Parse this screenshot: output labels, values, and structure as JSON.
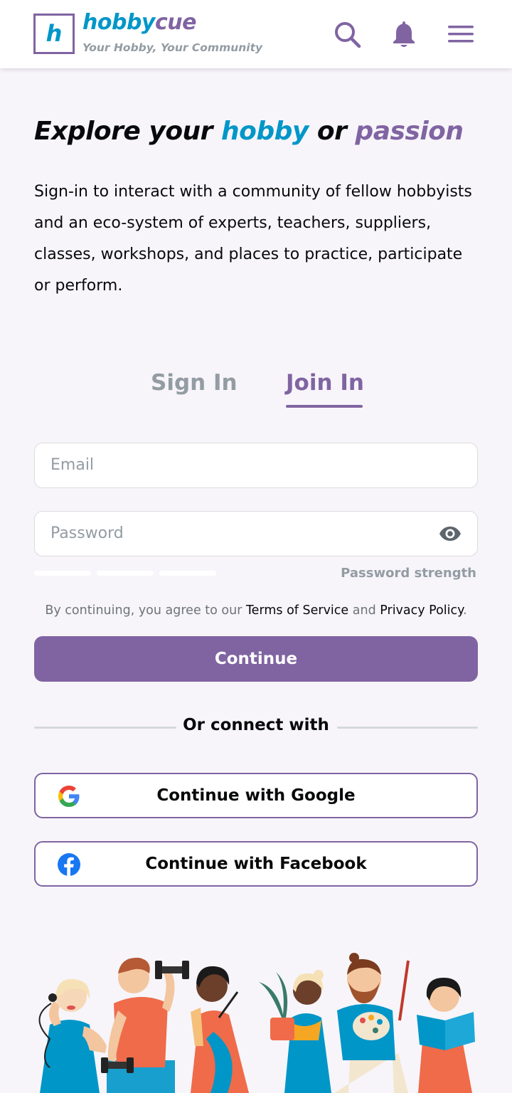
{
  "header": {
    "logo_letter": "h",
    "brand_part1": "hobby",
    "brand_part2": "cue",
    "tagline": "Your Hobby, Your Community",
    "icons": [
      "search-icon",
      "bell-icon",
      "menu-icon"
    ]
  },
  "hero": {
    "headline_part1": "Explore your ",
    "headline_hobby": "hobby",
    "headline_or": " or ",
    "headline_passion": "passion",
    "intro": "Sign-in to interact with a community of fellow hobbyists and an eco-system of experts, teachers, suppliers, classes, workshops, and places to practice, participate or perform."
  },
  "tabs": [
    {
      "label": "Sign In",
      "active": false
    },
    {
      "label": "Join In",
      "active": true
    }
  ],
  "form": {
    "email": {
      "placeholder": "Email",
      "value": ""
    },
    "password": {
      "placeholder": "Password",
      "value": ""
    },
    "password_strength_label": "Password strength",
    "terms_prefix": "By continuing, you agree to our ",
    "terms_link": "Terms of Service",
    "terms_and": " and ",
    "privacy_link": "Privacy Policy",
    "terms_suffix": ".",
    "continue_label": "Continue"
  },
  "social": {
    "or_text": "Or connect with",
    "google_label": "Continue with Google",
    "facebook_label": "Continue with Facebook"
  },
  "colors": {
    "primary": "#8064a2",
    "accent": "#0096c8",
    "muted": "#939ca3",
    "background": "#f7f5fa"
  }
}
